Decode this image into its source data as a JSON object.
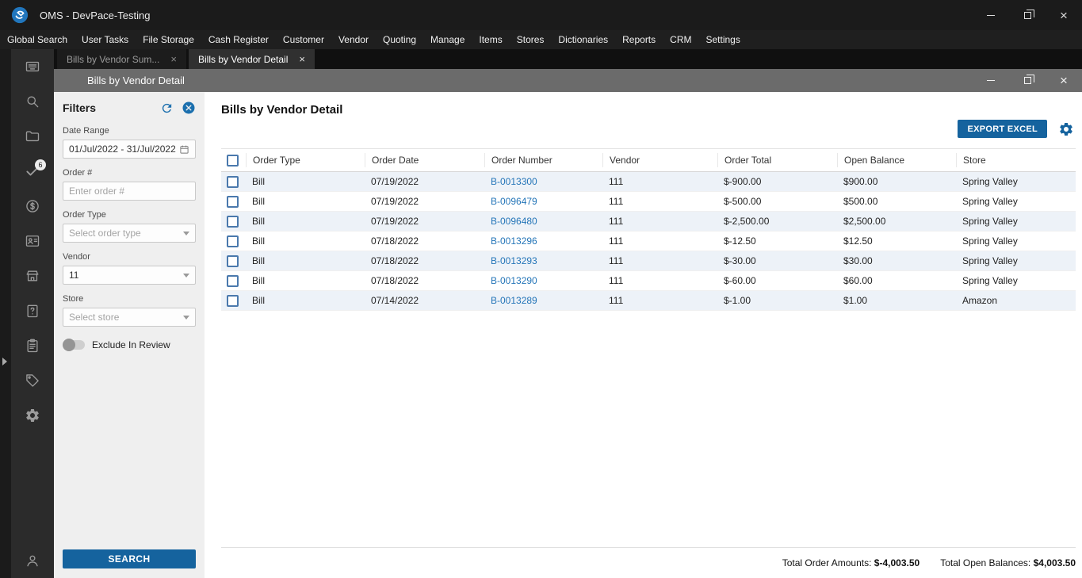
{
  "titlebar": {
    "title": "OMS - DevPace-Testing"
  },
  "menubar": {
    "items": [
      "Global Search",
      "User Tasks",
      "File Storage",
      "Cash Register",
      "Customer",
      "Vendor",
      "Quoting",
      "Manage",
      "Items",
      "Stores",
      "Dictionaries",
      "Reports",
      "CRM",
      "Settings"
    ]
  },
  "tabs": [
    {
      "label": "Bills by Vendor Sum...",
      "active": false
    },
    {
      "label": "Bills by Vendor Detail",
      "active": true
    }
  ],
  "sidebar": {
    "badge": "6",
    "icons": [
      "dashboard-icon",
      "search-icon",
      "folders-icon",
      "tasks-icon",
      "currency-icon",
      "contacts-icon",
      "store-icon",
      "clipboard-question-icon",
      "clipboard-list-icon",
      "tag-icon",
      "settings-icon",
      "user-icon"
    ]
  },
  "window": {
    "title": "Bills by Vendor Detail"
  },
  "filters": {
    "heading": "Filters",
    "date_range": {
      "label": "Date Range",
      "value": "01/Jul/2022 - 31/Jul/2022"
    },
    "order_number": {
      "label": "Order #",
      "placeholder": "Enter order #"
    },
    "order_type": {
      "label": "Order Type",
      "placeholder": "Select order type"
    },
    "vendor": {
      "label": "Vendor",
      "value": "11"
    },
    "store": {
      "label": "Store",
      "placeholder": "Select store"
    },
    "exclude_in_review": {
      "label": "Exclude In Review",
      "on": false
    },
    "search_label": "SEARCH"
  },
  "main": {
    "title": "Bills by Vendor Detail",
    "export_label": "EXPORT EXCEL",
    "table": {
      "columns": [
        "Order Type",
        "Order Date",
        "Order Number",
        "Vendor",
        "Order Total",
        "Open Balance",
        "Store"
      ],
      "rows": [
        {
          "order_type": "Bill",
          "order_date": "07/19/2022",
          "order_number": "B-0013300",
          "vendor": "111",
          "order_total": "$-900.00",
          "open_balance": "$900.00",
          "store": "Spring Valley"
        },
        {
          "order_type": "Bill",
          "order_date": "07/19/2022",
          "order_number": "B-0096479",
          "vendor": "111",
          "order_total": "$-500.00",
          "open_balance": "$500.00",
          "store": "Spring Valley"
        },
        {
          "order_type": "Bill",
          "order_date": "07/19/2022",
          "order_number": "B-0096480",
          "vendor": "111",
          "order_total": "$-2,500.00",
          "open_balance": "$2,500.00",
          "store": "Spring Valley"
        },
        {
          "order_type": "Bill",
          "order_date": "07/18/2022",
          "order_number": "B-0013296",
          "vendor": "111",
          "order_total": "$-12.50",
          "open_balance": "$12.50",
          "store": "Spring Valley"
        },
        {
          "order_type": "Bill",
          "order_date": "07/18/2022",
          "order_number": "B-0013293",
          "vendor": "111",
          "order_total": "$-30.00",
          "open_balance": "$30.00",
          "store": "Spring Valley"
        },
        {
          "order_type": "Bill",
          "order_date": "07/18/2022",
          "order_number": "B-0013290",
          "vendor": "111",
          "order_total": "$-60.00",
          "open_balance": "$60.00",
          "store": "Spring Valley"
        },
        {
          "order_type": "Bill",
          "order_date": "07/14/2022",
          "order_number": "B-0013289",
          "vendor": "111",
          "order_total": "$-1.00",
          "open_balance": "$1.00",
          "store": "Amazon"
        }
      ]
    },
    "totals": {
      "order_amounts_label": "Total Order Amounts:",
      "order_amounts_value": "$-4,003.50",
      "open_balances_label": "Total Open Balances:",
      "open_balances_value": "$4,003.50"
    }
  },
  "colors": {
    "accent": "#15639e",
    "link": "#2475b8",
    "row_alt": "#edf2f8"
  }
}
